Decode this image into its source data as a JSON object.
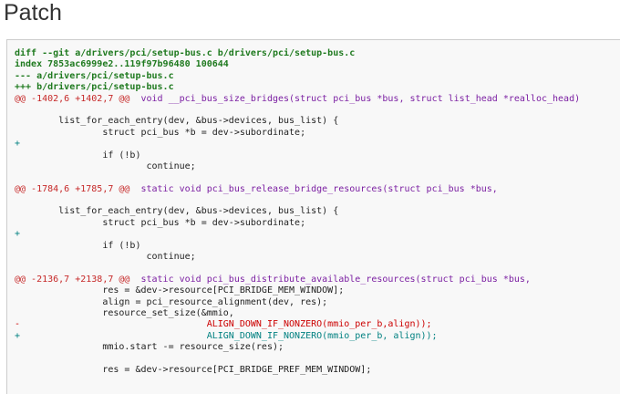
{
  "page_title": "Patch",
  "patch": {
    "lines": [
      {
        "type": "header",
        "text": "diff --git a/drivers/pci/setup-bus.c b/drivers/pci/setup-bus.c"
      },
      {
        "type": "header",
        "text": "index 7853ac6999e2..119f97b96480 100644"
      },
      {
        "type": "header",
        "text": "--- a/drivers/pci/setup-bus.c"
      },
      {
        "type": "header",
        "text": "+++ b/drivers/pci/setup-bus.c"
      },
      {
        "type": "hunk",
        "marker": "@@ -1402,6 +1402,7 @@",
        "func": "  void __pci_bus_size_bridges(struct pci_bus *bus, struct list_head *realloc_head)"
      },
      {
        "type": "ctx",
        "text": ""
      },
      {
        "type": "ctx",
        "text": "        list_for_each_entry(dev, &bus->devices, bus_list) {"
      },
      {
        "type": "ctx",
        "text": "                struct pci_bus *b = dev->subordinate;"
      },
      {
        "type": "add",
        "text": "+"
      },
      {
        "type": "ctx",
        "text": "                if (!b)"
      },
      {
        "type": "ctx",
        "text": "                        continue;"
      },
      {
        "type": "ctx",
        "text": ""
      },
      {
        "type": "hunk",
        "marker": "@@ -1784,6 +1785,7 @@",
        "func": "  static void pci_bus_release_bridge_resources(struct pci_bus *bus,"
      },
      {
        "type": "ctx",
        "text": ""
      },
      {
        "type": "ctx",
        "text": "        list_for_each_entry(dev, &bus->devices, bus_list) {"
      },
      {
        "type": "ctx",
        "text": "                struct pci_bus *b = dev->subordinate;"
      },
      {
        "type": "add",
        "text": "+"
      },
      {
        "type": "ctx",
        "text": "                if (!b)"
      },
      {
        "type": "ctx",
        "text": "                        continue;"
      },
      {
        "type": "ctx",
        "text": ""
      },
      {
        "type": "hunk",
        "marker": "@@ -2136,7 +2138,7 @@",
        "func": "  static void pci_bus_distribute_available_resources(struct pci_bus *bus,"
      },
      {
        "type": "ctx",
        "text": "                res = &dev->resource[PCI_BRIDGE_MEM_WINDOW];"
      },
      {
        "type": "ctx",
        "text": "                align = pci_resource_alignment(dev, res);"
      },
      {
        "type": "ctx",
        "text": "                resource_set_size(&mmio,"
      },
      {
        "type": "del",
        "text": "-                                  ALIGN_DOWN_IF_NONZERO(mmio_per_b,align));"
      },
      {
        "type": "add",
        "text": "+                                  ALIGN_DOWN_IF_NONZERO(mmio_per_b, align));"
      },
      {
        "type": "ctx",
        "text": "                mmio.start -= resource_size(res);"
      },
      {
        "type": "ctx",
        "text": ""
      },
      {
        "type": "ctx",
        "text": "                res = &dev->resource[PCI_BRIDGE_PREF_MEM_WINDOW];"
      },
      {
        "type": "ctx",
        "text": ""
      }
    ]
  }
}
